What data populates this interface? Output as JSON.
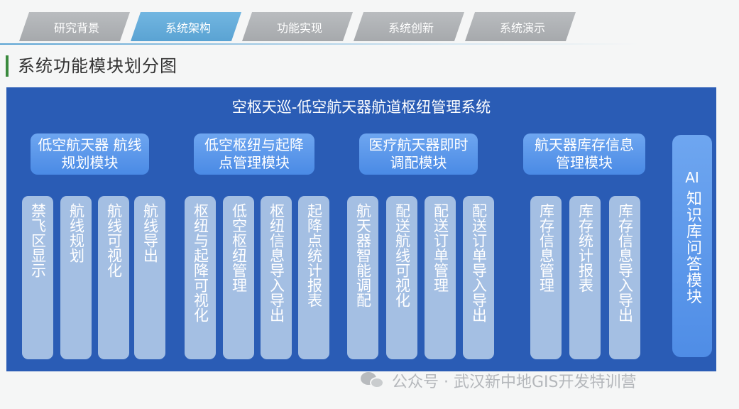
{
  "tabs": [
    {
      "label": "研究背景",
      "active": false
    },
    {
      "label": "系统架构",
      "active": true
    },
    {
      "label": "功能实现",
      "active": false
    },
    {
      "label": "系统创新",
      "active": false
    },
    {
      "label": "系统演示",
      "active": false
    }
  ],
  "section_title": "系统功能模块划分图",
  "diagram": {
    "system_title": "空枢天巡-低空航天器航道枢纽管理系统",
    "modules": [
      {
        "label": "低空航天器 航线规划模块",
        "leaves": [
          "禁飞区显示",
          "航线规划",
          "航线可视化",
          "航线导出"
        ]
      },
      {
        "label": "低空枢纽与起降点管理模块",
        "leaves": [
          "枢纽与起降可视化",
          "低空枢纽管理",
          "枢纽信息导入导出",
          "起降点统计报表"
        ]
      },
      {
        "label": "医疗航天器即时调配模块",
        "leaves": [
          "航天器智能调配",
          "配送航线可视化",
          "配送订单管理",
          "配送订单导入导出"
        ]
      },
      {
        "label": "航天器库存信息管理模块",
        "leaves": [
          "库存信息管理",
          "库存统计报表",
          "库存信息导入导出"
        ]
      }
    ],
    "ai_module": {
      "latin": "AI",
      "cjk": "知识库问答模块"
    }
  },
  "watermark": "公众号 · 武汉新中地GIS开发特训营",
  "colors": {
    "diagram_bg": "#2a5cb5",
    "module_bg": "#5a97ea",
    "leaf_bg": "#a4bfe3",
    "tab_active": "#5aa3d3",
    "tab_inactive": "#acafb2",
    "title_bar": "#3a8a3e"
  }
}
